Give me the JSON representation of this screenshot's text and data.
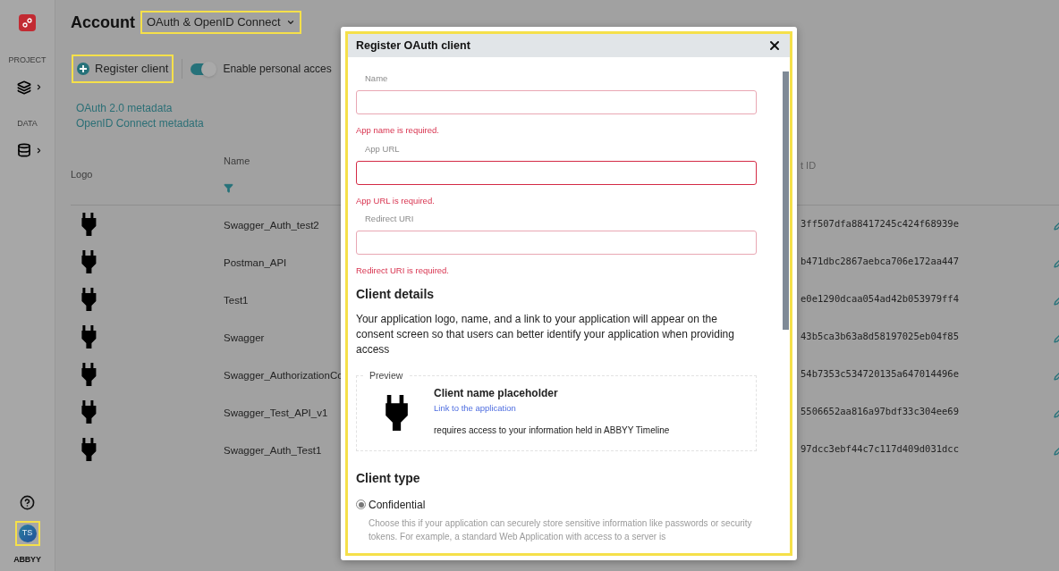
{
  "header": {
    "title": "Account",
    "section_select": "OAuth & OpenID Connect"
  },
  "sidebar": {
    "groups": [
      {
        "label": "PROJECT",
        "kind": "layers"
      },
      {
        "label": "DATA",
        "kind": "database"
      }
    ],
    "avatar": "TS",
    "brand": "ABBYY"
  },
  "toolbar": {
    "register_button": "Register client",
    "toggle": {
      "label": "Enable personal acces",
      "on": true
    }
  },
  "links": [
    "OAuth 2.0 metadata",
    "OpenID Connect metadata"
  ],
  "table": {
    "columns": [
      "Logo",
      "Name",
      "t ID"
    ],
    "rows": [
      {
        "name": "Swagger_Auth_test2",
        "client_id": "3ff507dfa88417245c424f68939e"
      },
      {
        "name": "Postman_API",
        "client_id": "b471dbc2867aebca706e172aa447"
      },
      {
        "name": "Test1",
        "client_id": "e0e1290dcaa054ad42b053979ff4"
      },
      {
        "name": "Swagger",
        "client_id": "43b5ca3b63a8d58197025eb04f85"
      },
      {
        "name": "Swagger_AuthorizationCo",
        "client_id": "54b7353c534720135a647014496e"
      },
      {
        "name": "Swagger_Test_API_v1",
        "client_id": "5506652aa816a97bdf33c304ee69"
      },
      {
        "name": "Swagger_Auth_Test1",
        "client_id": "97dcc3ebf44c7c117d409d031dcc"
      }
    ]
  },
  "dialog": {
    "title": "Register OAuth client",
    "fields": [
      {
        "label": "Name",
        "error": "App name is required.",
        "focused": false
      },
      {
        "label": "App URL",
        "error": "App URL is required.",
        "focused": true
      },
      {
        "label": "Redirect URI",
        "error": "Redirect URI is required.",
        "focused": false
      }
    ],
    "client_details": {
      "heading": "Client details",
      "description": "Your application logo, name, and a link to your application will appear on the consent screen so that users can better identify your application when providing access",
      "preview": {
        "legend": "Preview",
        "client_name": "Client name placeholder",
        "link": "Link to the application",
        "note": "requires access to your information held in ABBYY Timeline"
      }
    },
    "client_type": {
      "heading": "Client type",
      "options": [
        {
          "label": "Confidential",
          "selected": true,
          "description": "Choose this if your application can securely store sensitive information like passwords or security tokens. For example, a standard Web Application with access to a server is"
        }
      ]
    }
  }
}
